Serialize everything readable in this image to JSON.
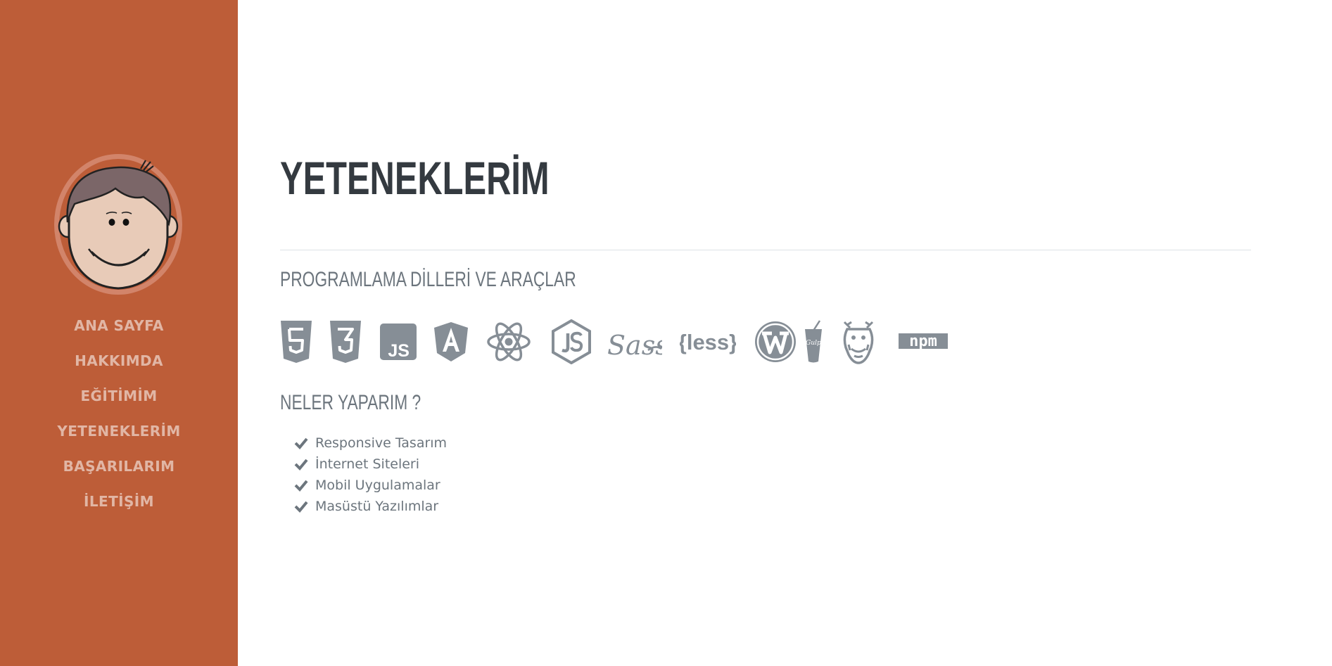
{
  "colors": {
    "sidebar_bg": "#bd5d38",
    "nav_text": "rgba(255,255,255,0.55)",
    "heading": "#343a40",
    "muted": "#6c757d",
    "icon_gray": "#868e96"
  },
  "sidebar": {
    "avatar_icon": "cartoon-face-avatar",
    "nav": [
      {
        "label": "ANA SAYFA"
      },
      {
        "label": "HAKKIMDA"
      },
      {
        "label": "EĞİTİMİM"
      },
      {
        "label": "YETENEKLERİM"
      },
      {
        "label": "BAŞARILARIM"
      },
      {
        "label": "İLETİŞİM"
      }
    ]
  },
  "main": {
    "title": "YETENEKLERİM",
    "tools_heading": "PROGRAMLAMA DİLLERİ VE ARAÇLAR",
    "tool_icons": [
      {
        "icon": "html5-icon"
      },
      {
        "icon": "css3-icon"
      },
      {
        "icon": "js-icon",
        "text": "JS"
      },
      {
        "icon": "angular-icon"
      },
      {
        "icon": "react-icon"
      },
      {
        "icon": "nodejs-icon"
      },
      {
        "icon": "sass-icon",
        "text": "Sass"
      },
      {
        "icon": "less-icon",
        "text": "{less}"
      },
      {
        "icon": "wordpress-icon"
      },
      {
        "icon": "gulp-icon",
        "text": "Gulp"
      },
      {
        "icon": "grunt-icon"
      },
      {
        "icon": "npm-icon",
        "text": "npm"
      }
    ],
    "work_heading": "NELER YAPARIM ?",
    "skills": [
      {
        "label": "Responsive Tasarım"
      },
      {
        "label": "İnternet Siteleri"
      },
      {
        "label": "Mobil Uygulamalar"
      },
      {
        "label": "Masüstü Yazılımlar"
      }
    ]
  }
}
